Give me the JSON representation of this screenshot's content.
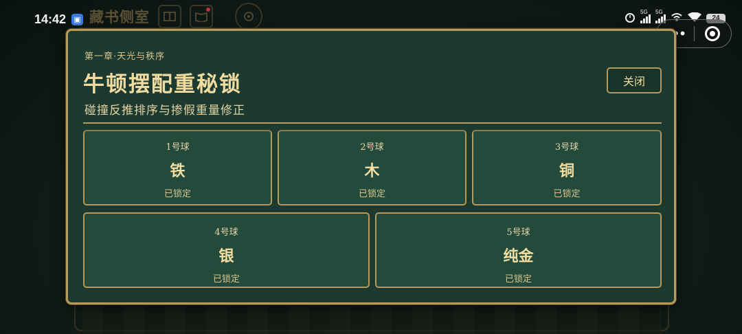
{
  "status_bar": {
    "time": "14:42",
    "signal_1": "5G",
    "signal_2": "5G",
    "battery": "24",
    "icons": [
      "app-icon",
      "alarm-icon",
      "signal-icon",
      "signal-icon",
      "hotspot-icon",
      "wifi-icon",
      "battery-icon"
    ]
  },
  "background": {
    "title": "藏书侧室",
    "icons": [
      "book-icon",
      "open-book-icon",
      "gear-icon"
    ]
  },
  "capsule": {
    "more_label": "•••",
    "icons": [
      "more-icon",
      "close-circle-icon"
    ]
  },
  "modal": {
    "chapter": "第一章·天光与秩序",
    "title": "牛顿摆配重秘锁",
    "subtitle": "碰撞反推排序与掺假重量修正",
    "close_label": "关闭",
    "balls": [
      {
        "number": "1号球",
        "material": "铁",
        "status": "已锁定"
      },
      {
        "number": "2号球",
        "material": "木",
        "status": "已锁定"
      },
      {
        "number": "3号球",
        "material": "铜",
        "status": "已锁定"
      },
      {
        "number": "4号球",
        "material": "银",
        "status": "已锁定"
      },
      {
        "number": "5号球",
        "material": "纯金",
        "status": "已锁定"
      }
    ]
  },
  "colors": {
    "modal_bg": "#1d3a30",
    "card_bg": "#234a3a",
    "gold_border": "#b69a5b",
    "gold_text": "#f0dba0"
  }
}
